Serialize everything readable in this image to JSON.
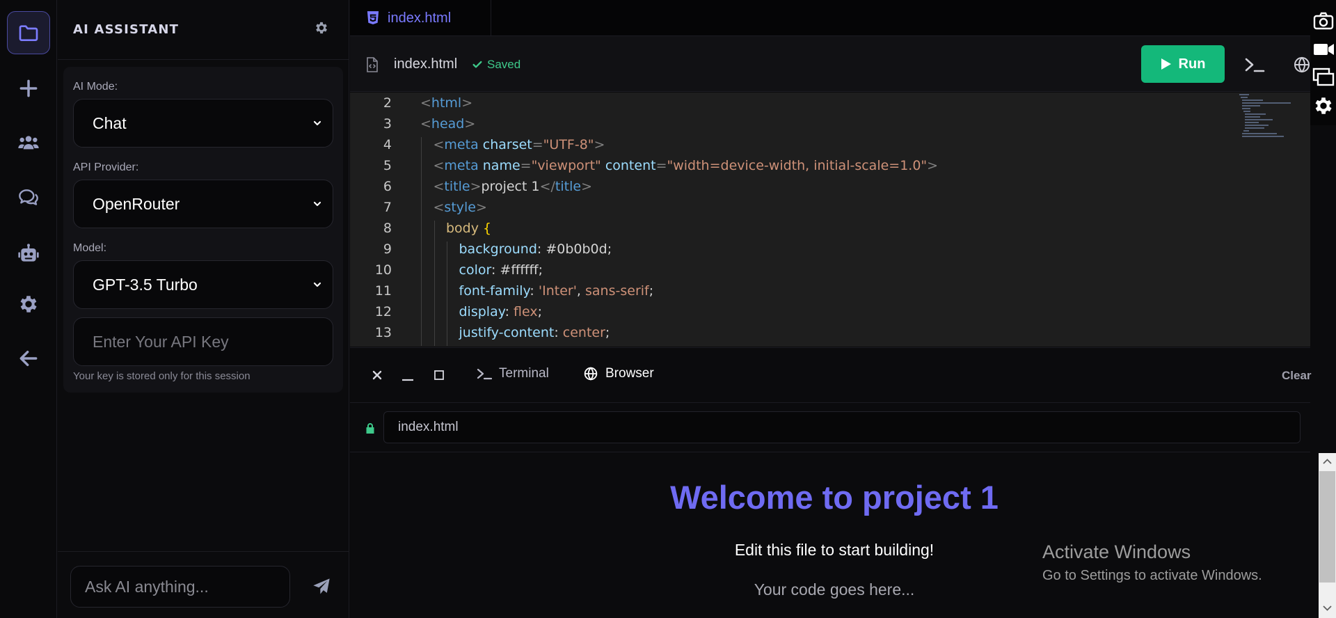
{
  "sidebar": {
    "items": [
      "explorer-icon",
      "new-icon",
      "team-icon",
      "chat-icon",
      "bot-icon",
      "settings-icon",
      "back-icon"
    ]
  },
  "panel": {
    "title": "AI ASSISTANT",
    "ai_mode_label": "AI Mode:",
    "ai_mode_value": "Chat",
    "api_provider_label": "API Provider:",
    "api_provider_value": "OpenRouter",
    "model_label": "Model:",
    "model_value": "GPT-3.5 Turbo",
    "api_key_placeholder": "Enter Your API Key",
    "api_key_hint": "Your key is stored only for this session",
    "chat_placeholder": "Ask AI anything..."
  },
  "editor": {
    "tab_label": "index.html",
    "file_name": "index.html",
    "saved_label": "Saved",
    "run_label": "Run",
    "lines": [
      {
        "n": "2",
        "indent": 0,
        "code": [
          [
            "punc",
            "<"
          ],
          [
            "tag",
            "html"
          ],
          [
            "punc",
            ">"
          ]
        ]
      },
      {
        "n": "3",
        "indent": 0,
        "code": [
          [
            "punc",
            "<"
          ],
          [
            "tag",
            "head"
          ],
          [
            "punc",
            ">"
          ]
        ]
      },
      {
        "n": "4",
        "indent": 1,
        "code": [
          [
            "punc",
            "<"
          ],
          [
            "tag",
            "meta"
          ],
          [
            "text",
            " "
          ],
          [
            "attr",
            "charset"
          ],
          [
            "punc",
            "="
          ],
          [
            "str",
            "\"UTF-8\""
          ],
          [
            "punc",
            ">"
          ]
        ]
      },
      {
        "n": "5",
        "indent": 1,
        "code": [
          [
            "punc",
            "<"
          ],
          [
            "tag",
            "meta"
          ],
          [
            "text",
            " "
          ],
          [
            "attr",
            "name"
          ],
          [
            "punc",
            "="
          ],
          [
            "str",
            "\"viewport\""
          ],
          [
            "text",
            " "
          ],
          [
            "attr",
            "content"
          ],
          [
            "punc",
            "="
          ],
          [
            "str",
            "\"width=device-width, initial-scale=1.0\""
          ],
          [
            "punc",
            ">"
          ]
        ]
      },
      {
        "n": "6",
        "indent": 1,
        "code": [
          [
            "punc",
            "<"
          ],
          [
            "tag",
            "title"
          ],
          [
            "punc",
            ">"
          ],
          [
            "text",
            "project 1"
          ],
          [
            "punc",
            "</"
          ],
          [
            "tag",
            "title"
          ],
          [
            "punc",
            ">"
          ]
        ]
      },
      {
        "n": "7",
        "indent": 1,
        "code": [
          [
            "punc",
            "<"
          ],
          [
            "tag",
            "style"
          ],
          [
            "punc",
            ">"
          ]
        ]
      },
      {
        "n": "8",
        "indent": 2,
        "code": [
          [
            "sel",
            "body"
          ],
          [
            "text",
            " "
          ],
          [
            "brace",
            "{"
          ]
        ]
      },
      {
        "n": "9",
        "indent": 3,
        "code": [
          [
            "prop",
            "background"
          ],
          [
            "text",
            ": #0b0b0d;"
          ]
        ]
      },
      {
        "n": "10",
        "indent": 3,
        "code": [
          [
            "prop",
            "color"
          ],
          [
            "text",
            ": #ffffff;"
          ]
        ]
      },
      {
        "n": "11",
        "indent": 3,
        "code": [
          [
            "prop",
            "font-family"
          ],
          [
            "text",
            ": "
          ],
          [
            "val",
            "'Inter'"
          ],
          [
            "text",
            ", "
          ],
          [
            "val",
            "sans-serif"
          ],
          [
            "text",
            ";"
          ]
        ]
      },
      {
        "n": "12",
        "indent": 3,
        "code": [
          [
            "prop",
            "display"
          ],
          [
            "text",
            ": "
          ],
          [
            "val",
            "flex"
          ],
          [
            "text",
            ";"
          ]
        ]
      },
      {
        "n": "13",
        "indent": 3,
        "code": [
          [
            "prop",
            "justify-content"
          ],
          [
            "text",
            ": "
          ],
          [
            "val",
            "center"
          ],
          [
            "text",
            ";"
          ]
        ]
      }
    ]
  },
  "bottom_panel": {
    "terminal_label": "Terminal",
    "browser_label": "Browser",
    "clear_label": "Clear",
    "url": "index.html"
  },
  "preview": {
    "heading": "Welcome to project 1",
    "paragraph": "Edit this file to start building!",
    "code_placeholder": "Your code goes here..."
  },
  "os_overlay": {
    "activate_title": "Activate Windows",
    "activate_sub": "Go to Settings to activate Windows."
  },
  "colors": {
    "accent": "#6f6bf2",
    "run_button": "#14b87a",
    "saved": "#3ec98a"
  }
}
